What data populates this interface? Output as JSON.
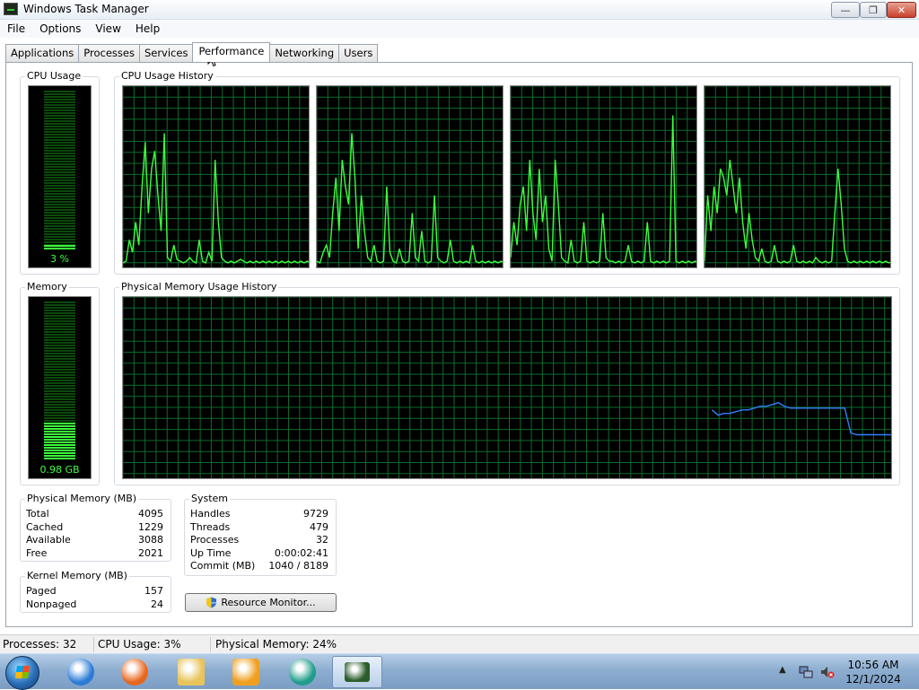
{
  "window": {
    "title": "Windows Task Manager",
    "controls": {
      "minimize": "—",
      "maximize": "❐",
      "close": "✕"
    }
  },
  "menu": [
    "File",
    "Options",
    "View",
    "Help"
  ],
  "tabs": [
    "Applications",
    "Processes",
    "Services",
    "Performance",
    "Networking",
    "Users"
  ],
  "active_tab": "Performance",
  "cpu": {
    "usage_title": "CPU Usage",
    "usage_text": "3 %",
    "usage_fraction": 0.03,
    "history_title": "CPU Usage History",
    "graph_color": "#3dff3d"
  },
  "memory": {
    "usage_title": "Memory",
    "usage_text": "0.98 GB",
    "usage_fraction": 0.24,
    "history_title": "Physical Memory Usage History",
    "graph_color": "#2f7fff"
  },
  "chart_data": [
    {
      "type": "line",
      "title": "CPU Usage History",
      "ylim": [
        0,
        100
      ],
      "x": [
        0,
        1,
        2,
        3,
        4,
        5,
        6,
        7,
        8,
        9,
        10,
        11,
        12,
        13,
        14,
        15,
        16,
        17,
        18,
        19,
        20,
        21,
        22,
        23,
        24,
        25,
        26,
        27,
        28,
        29,
        30,
        31,
        32,
        33,
        34,
        35,
        36,
        37,
        38,
        39,
        40,
        41,
        42,
        43,
        44,
        45,
        46,
        47,
        48,
        49,
        50,
        51,
        52,
        53,
        54,
        55,
        56,
        57,
        58,
        59
      ],
      "values": [
        2,
        3,
        15,
        8,
        25,
        12,
        45,
        70,
        30,
        55,
        65,
        40,
        20,
        75,
        5,
        3,
        12,
        4,
        3,
        2,
        3,
        5,
        3,
        2,
        15,
        3,
        2,
        8,
        3,
        60,
        25,
        5,
        3,
        2,
        3,
        2,
        3,
        4,
        3,
        2,
        3,
        2,
        3,
        2,
        3,
        2,
        3,
        2,
        3,
        2,
        3,
        2,
        3,
        2,
        3,
        2,
        3,
        2,
        3,
        2
      ]
    },
    {
      "type": "line",
      "title": "CPU Usage History",
      "ylim": [
        0,
        100
      ],
      "x": [
        0,
        1,
        2,
        3,
        4,
        5,
        6,
        7,
        8,
        9,
        10,
        11,
        12,
        13,
        14,
        15,
        16,
        17,
        18,
        19,
        20,
        21,
        22,
        23,
        24,
        25,
        26,
        27,
        28,
        29,
        30,
        31,
        32,
        33,
        34,
        35,
        36,
        37,
        38,
        39,
        40,
        41,
        42,
        43,
        44,
        45,
        46,
        47,
        48,
        49,
        50,
        51,
        52,
        53,
        54,
        55,
        56,
        57,
        58,
        59
      ],
      "values": [
        3,
        2,
        8,
        12,
        5,
        30,
        50,
        20,
        60,
        45,
        35,
        75,
        50,
        10,
        40,
        20,
        5,
        3,
        12,
        3,
        2,
        3,
        45,
        8,
        3,
        2,
        10,
        3,
        2,
        3,
        30,
        5,
        3,
        20,
        3,
        2,
        3,
        40,
        5,
        3,
        2,
        3,
        15,
        3,
        2,
        3,
        2,
        3,
        2,
        12,
        3,
        2,
        3,
        2,
        3,
        2,
        3,
        2,
        3,
        2
      ]
    },
    {
      "type": "line",
      "title": "CPU Usage History",
      "ylim": [
        0,
        100
      ],
      "x": [
        0,
        1,
        2,
        3,
        4,
        5,
        6,
        7,
        8,
        9,
        10,
        11,
        12,
        13,
        14,
        15,
        16,
        17,
        18,
        19,
        20,
        21,
        22,
        23,
        24,
        25,
        26,
        27,
        28,
        29,
        30,
        31,
        32,
        33,
        34,
        35,
        36,
        37,
        38,
        39,
        40,
        41,
        42,
        43,
        44,
        45,
        46,
        47,
        48,
        49,
        50,
        51,
        52,
        53,
        54,
        55,
        56,
        57,
        58,
        59
      ],
      "values": [
        5,
        25,
        12,
        35,
        45,
        20,
        60,
        30,
        15,
        55,
        25,
        40,
        10,
        3,
        60,
        35,
        5,
        3,
        2,
        15,
        3,
        2,
        3,
        25,
        3,
        2,
        3,
        2,
        3,
        30,
        5,
        3,
        3,
        2,
        3,
        2,
        3,
        12,
        3,
        2,
        3,
        2,
        3,
        25,
        3,
        2,
        3,
        2,
        3,
        2,
        3,
        85,
        3,
        2,
        3,
        2,
        3,
        2,
        3,
        2
      ]
    },
    {
      "type": "line",
      "title": "CPU Usage History",
      "ylim": [
        0,
        100
      ],
      "x": [
        0,
        1,
        2,
        3,
        4,
        5,
        6,
        7,
        8,
        9,
        10,
        11,
        12,
        13,
        14,
        15,
        16,
        17,
        18,
        19,
        20,
        21,
        22,
        23,
        24,
        25,
        26,
        27,
        28,
        29,
        30,
        31,
        32,
        33,
        34,
        35,
        36,
        37,
        38,
        39,
        40,
        41,
        42,
        43,
        44,
        45,
        46,
        47,
        48,
        49,
        50,
        51,
        52,
        53,
        54,
        55,
        56,
        57,
        58,
        59
      ],
      "values": [
        3,
        40,
        20,
        45,
        30,
        55,
        50,
        40,
        60,
        45,
        30,
        50,
        25,
        10,
        30,
        15,
        5,
        3,
        10,
        3,
        2,
        3,
        12,
        3,
        2,
        3,
        2,
        3,
        12,
        3,
        2,
        3,
        2,
        3,
        2,
        5,
        3,
        2,
        3,
        2,
        3,
        30,
        55,
        35,
        10,
        3,
        2,
        3,
        2,
        3,
        2,
        3,
        2,
        3,
        2,
        3,
        2,
        3,
        2,
        3
      ]
    },
    {
      "type": "line",
      "title": "Physical Memory Usage History",
      "ylim": [
        0,
        100
      ],
      "x": [
        0,
        1,
        2,
        3,
        4,
        5,
        6,
        7,
        8,
        9,
        10,
        11,
        12,
        13,
        14,
        15,
        16,
        17,
        18,
        19,
        20,
        21,
        22,
        23,
        24,
        25,
        26,
        27,
        28,
        29,
        30
      ],
      "values": [
        38,
        35,
        36,
        36,
        37,
        38,
        38,
        39,
        40,
        40,
        41,
        42,
        40,
        39,
        39,
        39,
        39,
        39,
        39,
        39,
        39,
        39,
        39,
        25,
        24,
        24,
        24,
        24,
        24,
        24,
        24
      ]
    }
  ],
  "physical_memory": {
    "title": "Physical Memory (MB)",
    "rows": [
      {
        "label": "Total",
        "value": "4095"
      },
      {
        "label": "Cached",
        "value": "1229"
      },
      {
        "label": "Available",
        "value": "3088"
      },
      {
        "label": "Free",
        "value": "2021"
      }
    ]
  },
  "kernel_memory": {
    "title": "Kernel Memory (MB)",
    "rows": [
      {
        "label": "Paged",
        "value": "157"
      },
      {
        "label": "Nonpaged",
        "value": "24"
      }
    ]
  },
  "system": {
    "title": "System",
    "rows": [
      {
        "label": "Handles",
        "value": "9729"
      },
      {
        "label": "Threads",
        "value": "479"
      },
      {
        "label": "Processes",
        "value": "32"
      },
      {
        "label": "Up Time",
        "value": "0:00:02:41"
      },
      {
        "label": "Commit (MB)",
        "value": "1040 / 8189"
      }
    ]
  },
  "resource_monitor_button": "Resource Monitor...",
  "status": {
    "processes": "Processes: 32",
    "cpu": "CPU Usage: 3%",
    "memory": "Physical Memory: 24%"
  },
  "taskbar": {
    "apps": [
      {
        "name": "internet-explorer-icon",
        "color": "#2b7bd6"
      },
      {
        "name": "firefox-icon",
        "color": "#e8661c"
      },
      {
        "name": "folder-icon",
        "color": "#e8c45a"
      },
      {
        "name": "media-player-icon",
        "color": "#f0a020"
      },
      {
        "name": "globe-app-icon",
        "color": "#1f9d8a"
      },
      {
        "name": "task-manager-icon",
        "color": "#2c5d2c"
      }
    ],
    "time": "10:56 AM",
    "date": "12/1/2024"
  }
}
